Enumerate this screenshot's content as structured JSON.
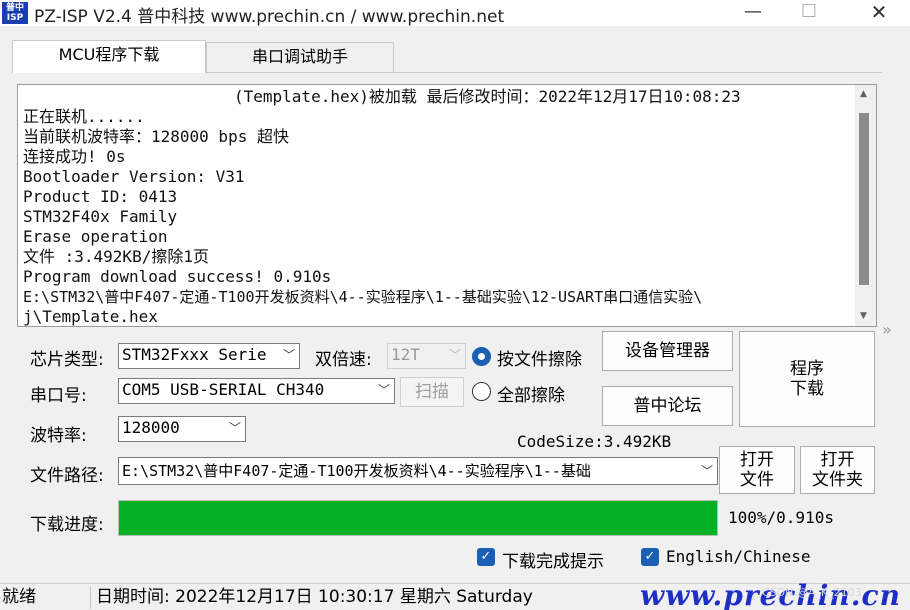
{
  "window": {
    "icon_top": "普中",
    "icon_bottom": "ISP",
    "title": "PZ-ISP V2.4 普中科技  www.prechin.cn / www.prechin.net",
    "min_glyph": "—",
    "max_glyph": "☐",
    "close_glyph": "✕"
  },
  "tabs": [
    {
      "label": "MCU程序下载",
      "active": true
    },
    {
      "label": "串口调试助手",
      "active": false
    }
  ],
  "log": {
    "header": "(Template.hex)被加载 最后修改时间：2022年12月17日10:08:23",
    "lines": [
      "正在联机......",
      "当前联机波特率：128000 bps  超快",
      "连接成功!    0s",
      "Bootloader Version: V31",
      "Product ID: 0413",
      "STM32F40x Family",
      "Erase operation",
      "文件 :3.492KB/擦除1页",
      "Program download success!    0.910s",
      "E:\\STM32\\普中F407-定通-T100开发板资料\\4--实验程序\\1--基础实验\\12-USART串口通信实验\\",
      "j\\Template.hex"
    ]
  },
  "form": {
    "chip_label": "芯片类型:",
    "chip_value": "STM32Fxxx Serie",
    "double_speed_label": "双倍速:",
    "double_speed_value": "12T",
    "port_label": "串口号:",
    "port_value": "COM5  USB-SERIAL CH340",
    "scan_label": "扫描",
    "baud_label": "波特率:",
    "baud_value": "128000",
    "path_label": "文件路径:",
    "path_value": "E:\\STM32\\普中F407-定通-T100开发板资料\\4--实验程序\\1--基础",
    "progress_label": "下载进度:",
    "progress_fraction": 1.0,
    "progress_text": "100%/0.910s",
    "codesize": "CodeSize:3.492KB"
  },
  "erase": {
    "by_file_label": "按文件擦除",
    "all_label": "全部擦除",
    "selected": "by_file"
  },
  "buttons": {
    "device_manager": "设备管理器",
    "forum": "普中论坛",
    "download": "程序\n下载",
    "open_file": "打开\n文件",
    "open_folder": "打开\n文件夹"
  },
  "checks": {
    "notify_label": "下载完成提示",
    "notify_checked": true,
    "lang_label": "English/Chinese",
    "lang_checked": true
  },
  "status": {
    "state": "就绪",
    "datetime": "日期时间:  2022年12月17日  10:30:17  星期六  Saturday",
    "brand": "www.prechin.cn",
    "watermark": "CSDN @A_K_2103"
  },
  "colors": {
    "progress_fill": "#06b025",
    "accent": "#1a5fb4",
    "brand": "#1d2fc4"
  }
}
